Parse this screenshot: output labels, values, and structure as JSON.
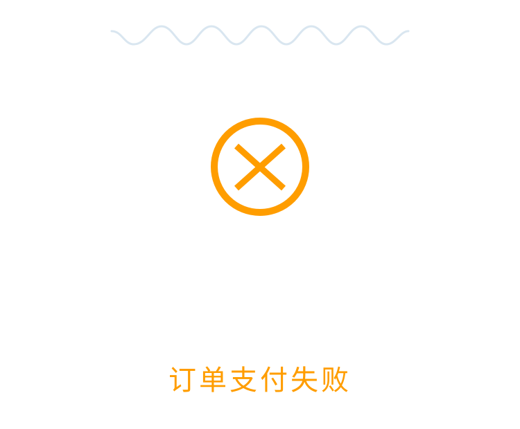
{
  "payment_result": {
    "status_text": "订单支付失败",
    "icon": "close-circle-icon"
  },
  "colors": {
    "accent": "#FF9D00",
    "receipt_outline": "#D9E6F0",
    "background": "#FFFFFF"
  }
}
